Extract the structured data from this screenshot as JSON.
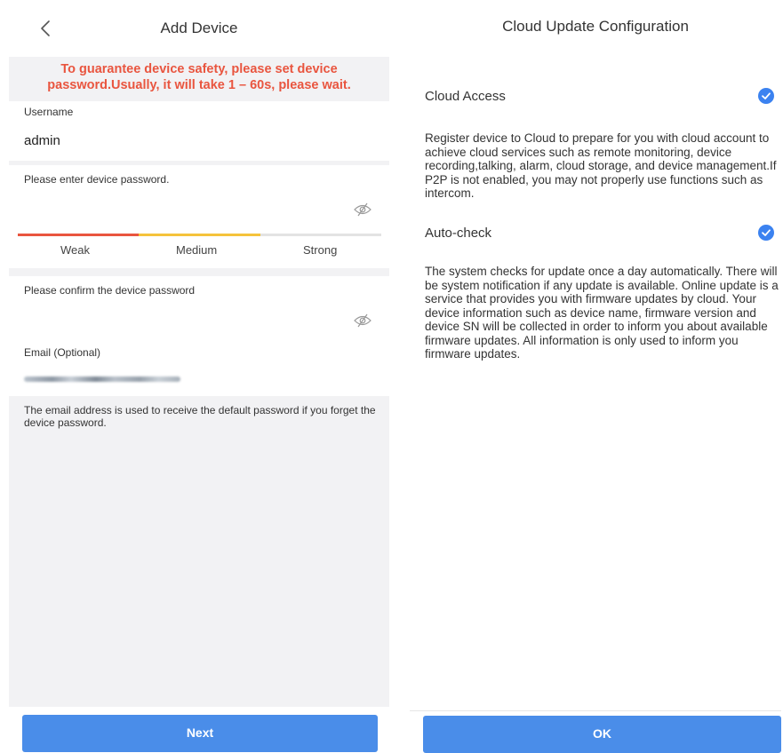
{
  "add_device": {
    "title": "Add Device",
    "warning_line1": "To guarantee device safety, please set device",
    "warning_line2": "password.Usually, it will take 1 – 60s, please wait.",
    "username_label": "Username",
    "username_value": "admin",
    "password_placeholder": "Please enter device password.",
    "strength": {
      "labels": [
        "Weak",
        "Medium",
        "Strong"
      ],
      "colors": [
        "#e9553f",
        "#f5c33b",
        "#e3e3e3"
      ],
      "level": "Medium"
    },
    "confirm_placeholder": "Please confirm the device password",
    "email_label": "Email (Optional)",
    "email_hint": "The email address is used to receive the default password if you forget the device password.",
    "next_label": "Next",
    "icons": {
      "back": "chevron-left-icon",
      "password_visibility": "eye-hidden-icon",
      "confirm_visibility": "eye-hidden-icon"
    }
  },
  "cloud_update": {
    "title": "Cloud Update Configuration",
    "cloud_access_label": "Cloud Access",
    "cloud_access_checked": true,
    "cloud_access_desc": "Register device to Cloud to prepare for you with cloud account to achieve cloud services such as remote monitoring, device recording,talking, alarm, cloud storage, and device management.If P2P is not enabled, you may not properly use functions such as intercom.",
    "auto_check_label": "Auto-check",
    "auto_check_checked": true,
    "auto_check_desc": "The system checks for update once a day automatically. There will be system notification if any update is available. Online update is a service that provides you with firmware updates by cloud. Your device information such as device name, firmware version and device SN will be collected in order to inform you about available firmware updates. All information is only used to inform you firmware updates.",
    "ok_label": "OK",
    "icons": {
      "check": "check-circle-icon"
    }
  },
  "colors": {
    "accent": "#4a8de9",
    "warning": "#e9553f",
    "check": "#3b82f0",
    "screen_bg": "#f2f2f4"
  }
}
